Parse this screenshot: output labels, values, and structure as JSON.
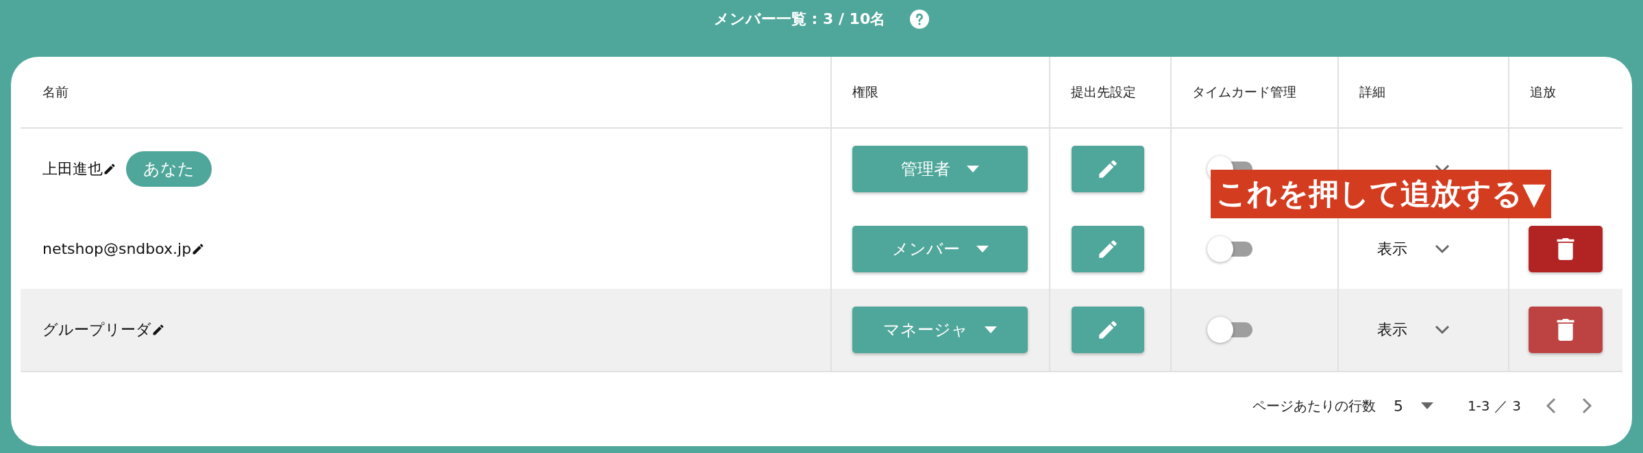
{
  "title": "メンバー一覧 : 3 / 10名",
  "columns": [
    "名前",
    "権限",
    "提出先設定",
    "タイムカード管理",
    "詳細",
    "追放"
  ],
  "rows": [
    {
      "name": "上田進也",
      "badge": "あなた",
      "role": "管理者",
      "timecard_on": false,
      "expanded": false,
      "highlighted": false
    },
    {
      "name": "netshop@sndbox.jp",
      "role": "メンバー",
      "timecard_on": false,
      "detail": "表示",
      "expanded": false,
      "highlighted": false,
      "delete_button": {
        "color": "#b22424"
      }
    },
    {
      "name": "グループリーダ",
      "role": "マネージャ",
      "timecard_on": false,
      "detail": "表示",
      "expanded": false,
      "highlighted": true,
      "delete_button": {
        "color": "#bd4343"
      }
    }
  ],
  "pagination": {
    "rows_label": "ページあたりの行数",
    "rows_per_page": "5",
    "range": "1-3 ／ 3"
  },
  "annotation": "これを押して追放する▼"
}
